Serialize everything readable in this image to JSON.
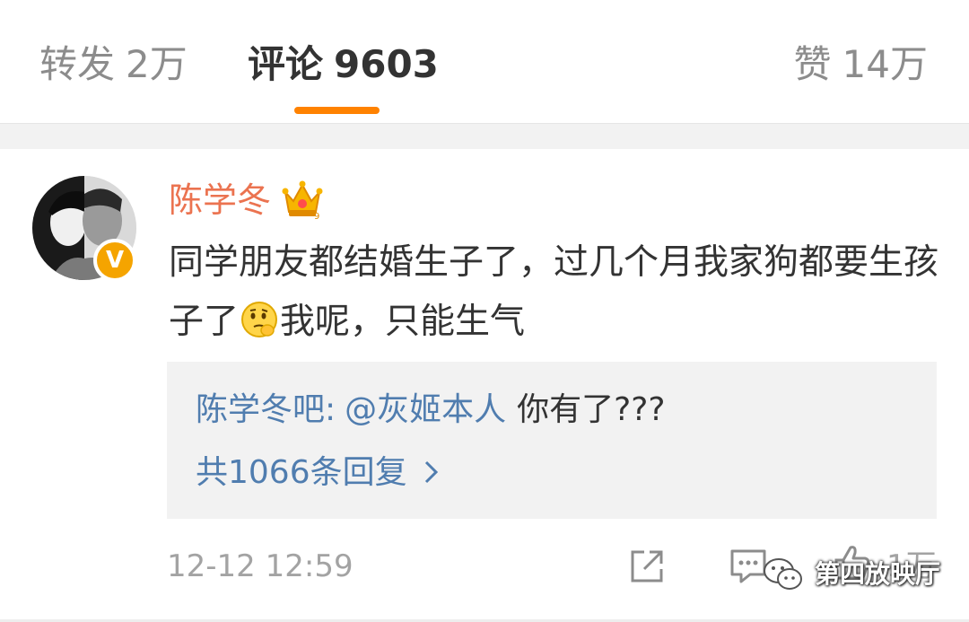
{
  "tabs": {
    "repost": {
      "label": "转发",
      "count": "2万"
    },
    "comments": {
      "label": "评论",
      "count": "9603"
    },
    "likes": {
      "label": "赞",
      "count": "14万"
    }
  },
  "comment": {
    "username": "陈学冬",
    "text_part1": "同学朋友都结婚生子了，过几个月我家狗都要生孩子了",
    "text_part2": "我呢，只能生气",
    "emoji": "thinking-emoji",
    "verified_badge": "V",
    "timestamp": "12-12 12:59",
    "like_count": "1万"
  },
  "reply": {
    "author": "陈学冬吧:",
    "mention": "@灰姬本人",
    "text": "你有了???",
    "count_label": "共1066条回复"
  },
  "watermark": {
    "text": "第四放映厅"
  },
  "colors": {
    "accent": "#ff8200",
    "username": "#eb7350",
    "link": "#507daf",
    "muted": "#a3a3a3",
    "badge": "#f5a400"
  }
}
